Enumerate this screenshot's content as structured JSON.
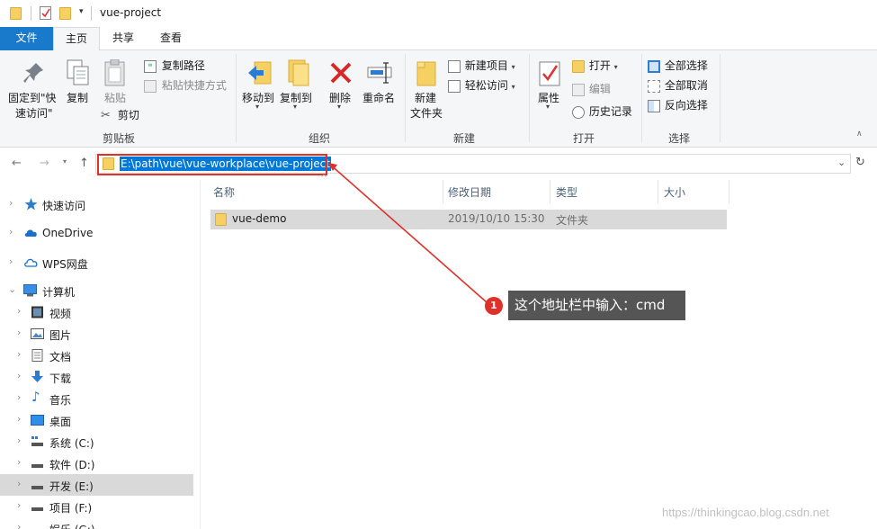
{
  "window": {
    "title": "vue-project"
  },
  "tabs": [
    {
      "label": "文件"
    },
    {
      "label": "主页"
    },
    {
      "label": "共享"
    },
    {
      "label": "查看"
    }
  ],
  "ribbon": {
    "clipboard": {
      "label": "剪贴板",
      "pin_line1": "固定到\"快",
      "pin_line2": "速访问\"",
      "copy": "复制",
      "paste": "粘贴",
      "copy_path": "复制路径",
      "paste_shortcut": "粘贴快捷方式",
      "cut": "剪切"
    },
    "organize": {
      "label": "组织",
      "move_to": "移动到",
      "copy_to": "复制到",
      "delete": "删除",
      "rename": "重命名"
    },
    "new": {
      "label": "新建",
      "new_folder_line1": "新建",
      "new_folder_line2": "文件夹",
      "new_item": "新建项目",
      "easy_access": "轻松访问"
    },
    "open": {
      "label": "打开",
      "properties": "属性",
      "open": "打开",
      "edit": "编辑",
      "history": "历史记录"
    },
    "select": {
      "label": "选择",
      "select_all": "全部选择",
      "select_none": "全部取消",
      "invert": "反向选择"
    }
  },
  "address": {
    "path": "E:\\path\\vue\\vue-workplace\\vue-project"
  },
  "nav_pane": {
    "items": [
      {
        "label": "快速访问"
      },
      {
        "label": "OneDrive"
      },
      {
        "label": "WPS网盘"
      },
      {
        "label": "计算机"
      },
      {
        "label": "视频"
      },
      {
        "label": "图片"
      },
      {
        "label": "文档"
      },
      {
        "label": "下载"
      },
      {
        "label": "音乐"
      },
      {
        "label": "桌面"
      },
      {
        "label": "系统 (C:)"
      },
      {
        "label": "软件 (D:)"
      },
      {
        "label": "开发 (E:)"
      },
      {
        "label": "项目 (F:)"
      },
      {
        "label": "娱乐 (G:)"
      }
    ]
  },
  "file_list": {
    "columns": [
      {
        "label": "名称"
      },
      {
        "label": "修改日期"
      },
      {
        "label": "类型"
      },
      {
        "label": "大小"
      }
    ],
    "rows": [
      {
        "name": "vue-demo",
        "modified": "2019/10/10 15:30",
        "type": "文件夹",
        "size": ""
      }
    ]
  },
  "annotation": {
    "number": "1",
    "text": "这个地址栏中输入：cmd"
  },
  "watermark": "https://thinkingcao.blog.csdn.net",
  "colors": {
    "accent": "#1979ca",
    "selection": "#0078d7",
    "highlight": "#e0302a",
    "tooltip": "#555555",
    "folder": "#f7d063"
  }
}
